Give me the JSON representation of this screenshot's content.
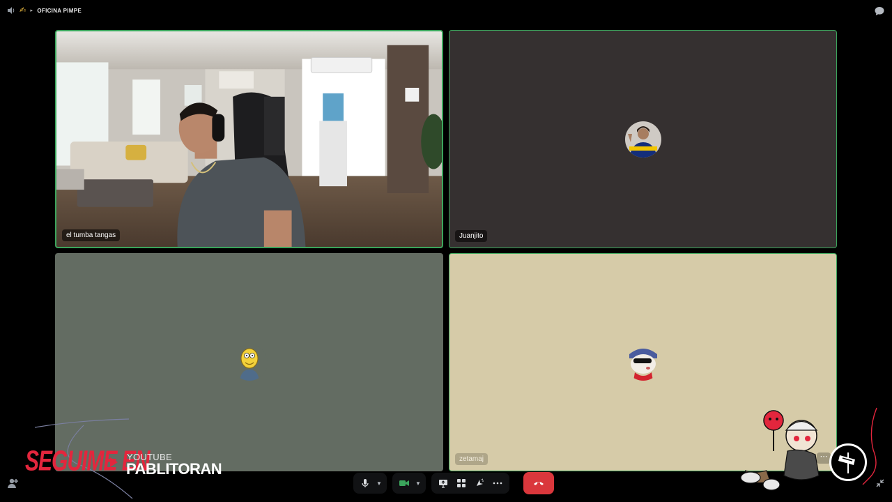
{
  "server": {
    "name": "OFICINA PIMPE"
  },
  "tiles": [
    {
      "name": "el tumba tangas",
      "type": "video"
    },
    {
      "name": "Juanjito",
      "type": "avatar"
    },
    {
      "name": "",
      "type": "avatar"
    },
    {
      "name": "zetamaj",
      "type": "avatar"
    }
  ],
  "controls": {
    "hangup_color": "#da373c",
    "camera_color": "#3ba55c"
  },
  "overlay": {
    "cta": "SEGUIME EN",
    "platform": "YOUTUBE",
    "channel": "PABLITORAN"
  },
  "colors": {
    "speaking_border": "#3ba55c",
    "accent_red": "#e3263d"
  }
}
